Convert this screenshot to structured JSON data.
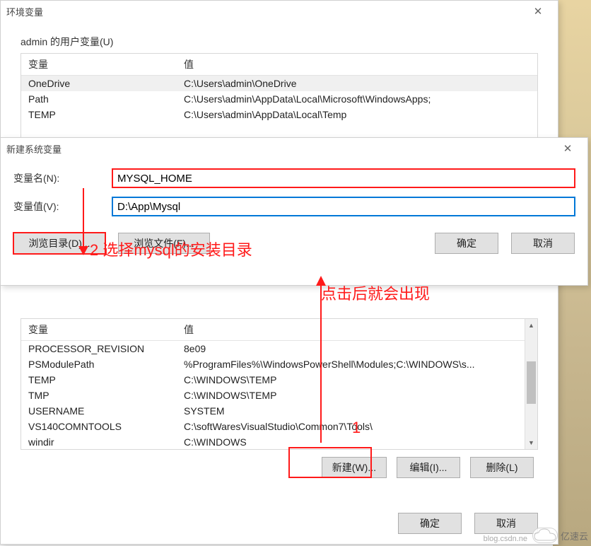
{
  "env_dialog": {
    "title": "环境变量",
    "user_section_label": "admin 的用户变量(U)",
    "col_var": "变量",
    "col_val": "值",
    "user_rows": [
      {
        "var": "OneDrive",
        "val": "C:\\Users\\admin\\OneDrive"
      },
      {
        "var": "Path",
        "val": "C:\\Users\\admin\\AppData\\Local\\Microsoft\\WindowsApps;"
      },
      {
        "var": "TEMP",
        "val": "C:\\Users\\admin\\AppData\\Local\\Temp"
      }
    ],
    "sys_rows": [
      {
        "var": "PROCESSOR_REVISION",
        "val": "8e09"
      },
      {
        "var": "PSModulePath",
        "val": "%ProgramFiles%\\WindowsPowerShell\\Modules;C:\\WINDOWS\\s..."
      },
      {
        "var": "TEMP",
        "val": "C:\\WINDOWS\\TEMP"
      },
      {
        "var": "TMP",
        "val": "C:\\WINDOWS\\TEMP"
      },
      {
        "var": "USERNAME",
        "val": "SYSTEM"
      },
      {
        "var": "VS140COMNTOOLS",
        "val": "C:\\softWaresVisualStudio\\Common7\\Tools\\"
      },
      {
        "var": "windir",
        "val": "C:\\WINDOWS"
      }
    ],
    "btn_new": "新建(W)...",
    "btn_edit": "编辑(I)...",
    "btn_delete": "删除(L)",
    "btn_ok": "确定",
    "btn_cancel": "取消"
  },
  "new_var_dialog": {
    "title": "新建系统变量",
    "label_name": "变量名(N):",
    "label_value": "变量值(V):",
    "name_value": "MYSQL_HOME",
    "value_value": "D:\\App\\Mysql",
    "btn_browse_dir": "浏览目录(D)...",
    "btn_browse_file": "浏览文件(F)...",
    "btn_ok": "确定",
    "btn_cancel": "取消"
  },
  "annotations": {
    "anno2": "2 选择mysql的安装目录",
    "anno1_text": "点击后就会出现",
    "anno1_num": "1"
  },
  "watermark": {
    "text": "亿速云",
    "sub": "blog.csdn.ne"
  }
}
